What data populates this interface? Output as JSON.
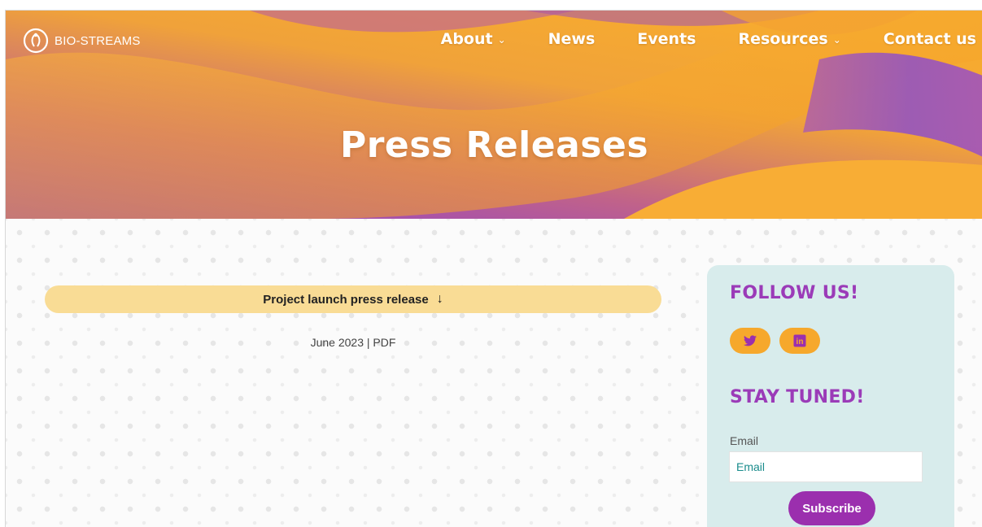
{
  "brand": {
    "name": "BIO-STREAMS",
    "logo_icon": "leaf-figure-logo"
  },
  "nav": {
    "items": [
      {
        "label": "About",
        "has_dropdown": true
      },
      {
        "label": "News",
        "has_dropdown": false
      },
      {
        "label": "Events",
        "has_dropdown": false
      },
      {
        "label": "Resources",
        "has_dropdown": true
      },
      {
        "label": "Contact us",
        "has_dropdown": false
      }
    ],
    "dropdown_icon": "⌄"
  },
  "hero": {
    "title": "Press Releases"
  },
  "press": {
    "item_label": "Project launch press release",
    "download_icon": "↓",
    "meta": "June 2023 | PDF"
  },
  "sidebar": {
    "follow_heading": "FOLLOW US!",
    "social": [
      {
        "name": "twitter-icon"
      },
      {
        "name": "linkedin-icon",
        "glyph": "in"
      }
    ],
    "stay_heading": "STAY TUNED!",
    "email_label": "Email",
    "email_placeholder": "Email",
    "subscribe_label": "Subscribe"
  },
  "colors": {
    "accent_orange": "#f6a82c",
    "accent_purple": "#9b2fae",
    "pill_yellow": "#f9dc95",
    "sidebar_bg": "#d8ecec"
  }
}
